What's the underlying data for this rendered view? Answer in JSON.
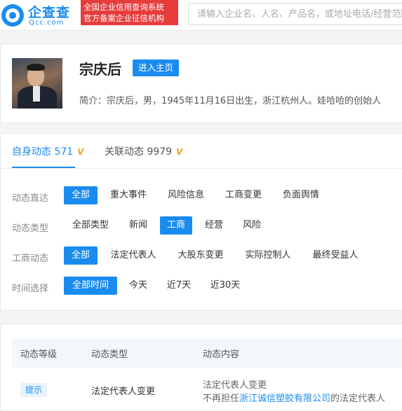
{
  "header": {
    "logo_cn": "企查查",
    "logo_en": "Qcc.com",
    "slogan_line1": "全国企业信用查询系统",
    "slogan_line2": "官方备案企业征信机构",
    "search_placeholder": "请输入企业名、人名、产品名，或地址电话/经营范围"
  },
  "profile": {
    "name": "宗庆后",
    "home_button": "进入主页",
    "intro": "简介：宗庆后，男，1945年11月16日出生，浙江杭州人。娃哈哈的创始人"
  },
  "tabs": [
    {
      "label": "自身动态",
      "count": "571",
      "badge": "V"
    },
    {
      "label": "关联动态",
      "count": "9979",
      "badge": "V"
    }
  ],
  "filters": [
    {
      "label": "动态直达",
      "options": [
        "全部",
        "重大事件",
        "风险信息",
        "工商变更",
        "负面舆情"
      ],
      "selected": "全部"
    },
    {
      "label": "动态类型",
      "options": [
        "全部类型",
        "新闻",
        "工商",
        "经营",
        "风险"
      ],
      "selected": "工商"
    },
    {
      "label": "工商动态",
      "options": [
        "全部",
        "法定代表人",
        "大股东变更",
        "实际控制人",
        "最终受益人"
      ],
      "selected": "全部"
    },
    {
      "label": "时间选择",
      "options": [
        "全部时间",
        "今天",
        "近7天",
        "近30天"
      ],
      "selected": "全部时间"
    }
  ],
  "table": {
    "headers": [
      "动态等级",
      "动态类型",
      "动态内容"
    ],
    "rows": [
      {
        "level": "提示",
        "type": "法定代表人变更",
        "content_title": "法定代表人变更",
        "content_prefix": "不再担任",
        "content_company": "浙江诚信塑胶有限公司",
        "content_suffix": "的法定代表人"
      }
    ]
  },
  "colors": {
    "accent": "#1a8cf0",
    "slogan_bg": "#e63c3c",
    "vip": "#f0a020"
  }
}
